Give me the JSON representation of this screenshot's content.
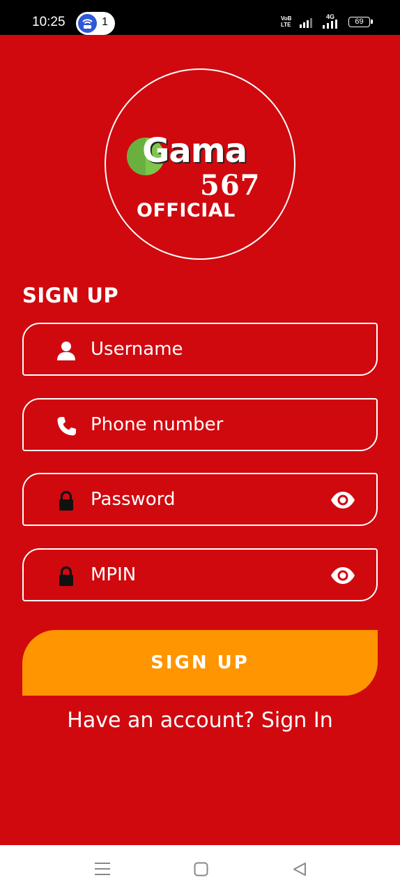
{
  "status_bar": {
    "time": "10:25",
    "notification_count": "1",
    "network_label_top": "VoB",
    "network_label_bottom": "LTE",
    "network_type": "4G",
    "battery": "69"
  },
  "logo": {
    "word": "Gama",
    "number": "567",
    "tagline": "OFFICIAL"
  },
  "form": {
    "title": "SIGN UP",
    "fields": [
      {
        "placeholder": "Username",
        "icon": "person-icon"
      },
      {
        "placeholder": "Phone number",
        "icon": "phone-icon"
      },
      {
        "placeholder": "Password",
        "icon": "lock-icon"
      },
      {
        "placeholder": "MPIN",
        "icon": "lock-icon"
      }
    ],
    "submit_label": "SIGN UP",
    "signin_prompt": "Have an account?",
    "signin_link": "Sign In"
  },
  "colors": {
    "background": "#d0090f",
    "button": "#ff9500",
    "text": "#ffffff",
    "logo_accent": "#7ec64b"
  }
}
